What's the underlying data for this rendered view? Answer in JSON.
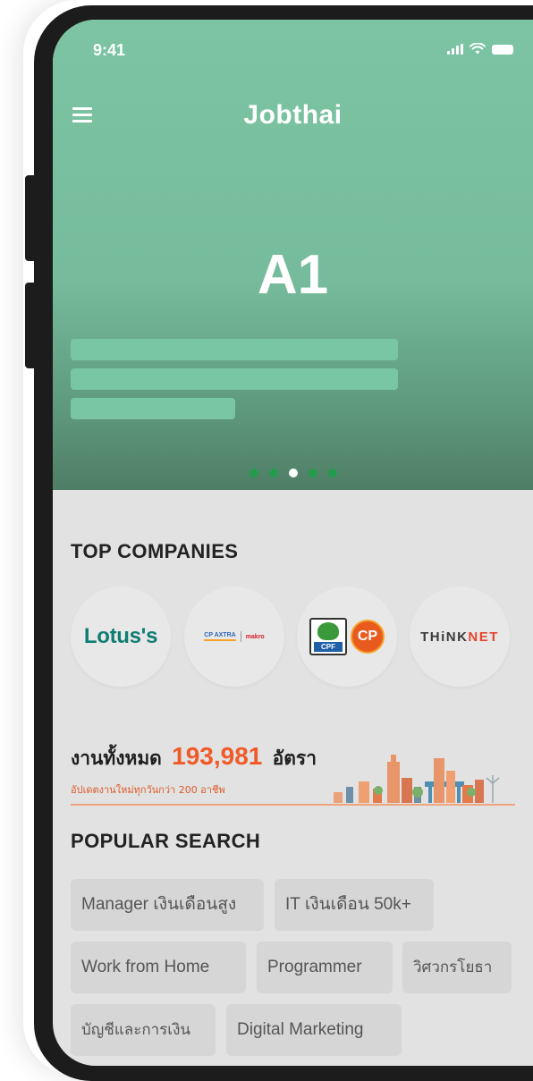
{
  "status_bar": {
    "time": "9:41"
  },
  "header": {
    "title": "Jobthai"
  },
  "hero": {
    "slide_title": "A1",
    "slide_count": 5,
    "active_slide": 3
  },
  "top_companies": {
    "heading": "TOP COMPANIES",
    "companies": [
      {
        "logo": "Lotus's"
      },
      {
        "logo_left": "CP AXTRA",
        "logo_right": "makro"
      },
      {
        "logo_left": "CPF",
        "logo_right": "CP"
      },
      {
        "logo_prefix": "THiNK",
        "logo_suffix": "NET"
      }
    ]
  },
  "jobs_banner": {
    "prefix": "งานทั้งหมด",
    "count": "193,981",
    "suffix": "อัตรา",
    "subtitle": "อัปเดตงานใหม่ทุกวันกว่า 200 อาชีพ"
  },
  "popular_search": {
    "heading": "POPULAR SEARCH",
    "tags": [
      "Manager เงินเดือนสูง",
      "IT เงินเดือน 50k+",
      "Work from Home",
      "Programmer",
      "วิศวกรโยธา",
      "บัญชีและการเงิน",
      "Digital Marketing"
    ]
  },
  "colors": {
    "hero_green": "#7cc4a3",
    "dot_active": "#ffffff",
    "dot_inactive": "#249c4e",
    "accent_orange": "#f05a28"
  }
}
